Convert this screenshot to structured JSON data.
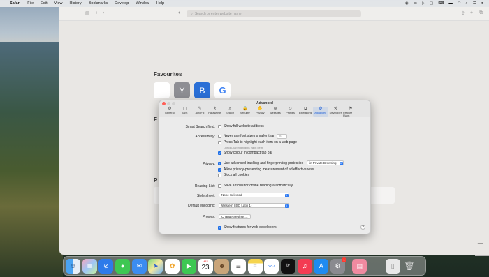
{
  "menubar": {
    "app": "Safari",
    "items": [
      "File",
      "Edit",
      "View",
      "History",
      "Bookmarks",
      "Develop",
      "Window",
      "Help"
    ]
  },
  "safari": {
    "address_placeholder": "Search or enter website name",
    "favourites_title": "Favourites",
    "favourites": [
      {
        "name": "Apple",
        "glyph": ""
      },
      {
        "name": "Yahoo",
        "glyph": "Y"
      },
      {
        "name": "Bing",
        "glyph": "B"
      },
      {
        "name": "Google",
        "glyph": "G"
      }
    ],
    "bg_letter_f": "F",
    "bg_letter_p": "P"
  },
  "prefs": {
    "title": "Advanced",
    "tabs": [
      {
        "label": "General",
        "icon": "⚙"
      },
      {
        "label": "Tabs",
        "icon": "▢"
      },
      {
        "label": "AutoFill",
        "icon": "✎"
      },
      {
        "label": "Passwords",
        "icon": "⚷"
      },
      {
        "label": "Search",
        "icon": "⌕"
      },
      {
        "label": "Security",
        "icon": "🔒"
      },
      {
        "label": "Privacy",
        "icon": "✋"
      },
      {
        "label": "Websites",
        "icon": "⊕"
      },
      {
        "label": "Profiles",
        "icon": "☺"
      },
      {
        "label": "Extensions",
        "icon": "⧉"
      },
      {
        "label": "Advanced",
        "icon": "⚙"
      },
      {
        "label": "Developer",
        "icon": "⚒"
      },
      {
        "label": "Feature Flags",
        "icon": "⚑"
      }
    ],
    "smart_search_label": "Smart Search field:",
    "smart_search_option": "Show full website address",
    "accessibility_label": "Accessibility:",
    "never_font_size": "Never use font sizes smaller than",
    "font_size_value": "9",
    "press_tab": "Press Tab to highlight each item on a web page",
    "press_tab_sub": "Option-Tab highlights each item.",
    "show_colour": "Show colour in compact tab bar",
    "privacy_label": "Privacy:",
    "advanced_tracking": "Use advanced tracking and fingerprinting protection",
    "tracking_select": "in Private Browsing",
    "allow_ads": "Allow privacy-preserving measurement of ad effectiveness",
    "block_cookies": "Block all cookies",
    "reading_list_label": "Reading List:",
    "reading_list_option": "Save articles for offline reading automatically",
    "style_sheet_label": "Style sheet:",
    "style_sheet_value": "None Selected",
    "encoding_label": "Default encoding:",
    "encoding_value": "Western (ISO Latin 1)",
    "proxies_label": "Proxies:",
    "proxies_button": "Change Settings…",
    "web_dev": "Show features for web developers",
    "help": "?"
  },
  "dock": {
    "calendar_month": "MAY",
    "calendar_day": "23",
    "appstore_badge": "1",
    "items": [
      "Finder",
      "Launchpad",
      "Safari",
      "Messages",
      "Mail",
      "Maps",
      "Photos",
      "FaceTime",
      "Calendar",
      "Contacts",
      "Reminders",
      "Notes",
      "Freeform",
      "TV",
      "Music",
      "App Store",
      "System Settings",
      "Books",
      "Downloads",
      "Trash"
    ]
  },
  "colors": {
    "accent": "#1e6fe8"
  }
}
